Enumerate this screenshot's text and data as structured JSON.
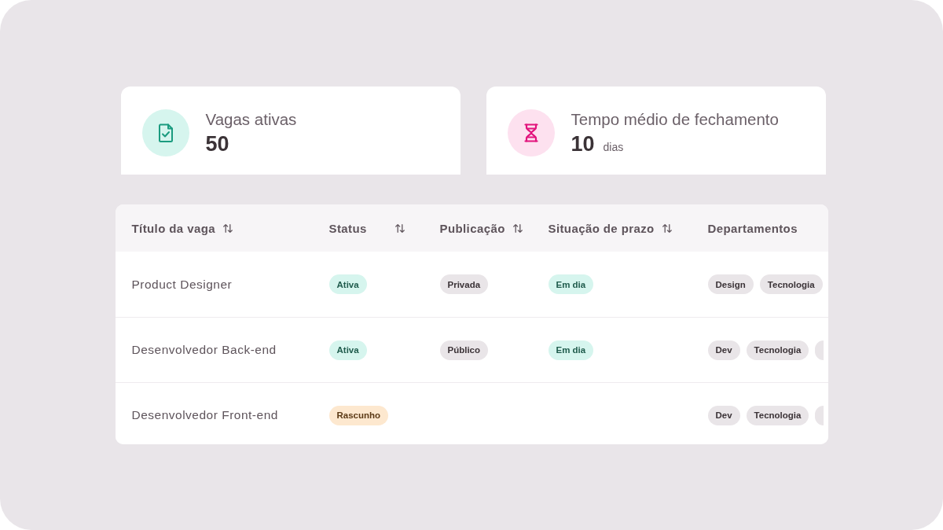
{
  "stat_cards": [
    {
      "kind": "document-check",
      "title": "Vagas ativas",
      "value": "50"
    },
    {
      "kind": "hourglass",
      "title": "Tempo médio de fechamento",
      "value": "10",
      "unit": "dias"
    }
  ],
  "table": {
    "columns": [
      {
        "label": "Título da vaga",
        "sortable": true
      },
      {
        "label": "Status",
        "sortable": true
      },
      {
        "label": "Publicação",
        "sortable": true
      },
      {
        "label": "Situação de prazo",
        "sortable": true
      },
      {
        "label": "Departamentos",
        "sortable": false
      }
    ],
    "rows": [
      {
        "title": "Product Designer",
        "status": {
          "label": "Ativa",
          "kind": "success"
        },
        "publication": {
          "label": "Privada",
          "kind": "neutral"
        },
        "deadline": {
          "label": "Em dia",
          "kind": "success"
        },
        "departments": [
          "Design",
          "Tecnologia"
        ],
        "more_departments_cut_off": false
      },
      {
        "title": "Desenvolvedor Back-end",
        "status": {
          "label": "Ativa",
          "kind": "success"
        },
        "publication": {
          "label": "Público",
          "kind": "neutral"
        },
        "deadline": {
          "label": "Em dia",
          "kind": "success"
        },
        "departments": [
          "Dev",
          "Tecnologia"
        ],
        "more_departments_cut_off": true
      },
      {
        "title": "Desenvolvedor Front-end",
        "status": {
          "label": "Rascunho",
          "kind": "warning"
        },
        "departments": [
          "Dev",
          "Tecnologia"
        ],
        "more_departments_cut_off": true
      }
    ]
  }
}
